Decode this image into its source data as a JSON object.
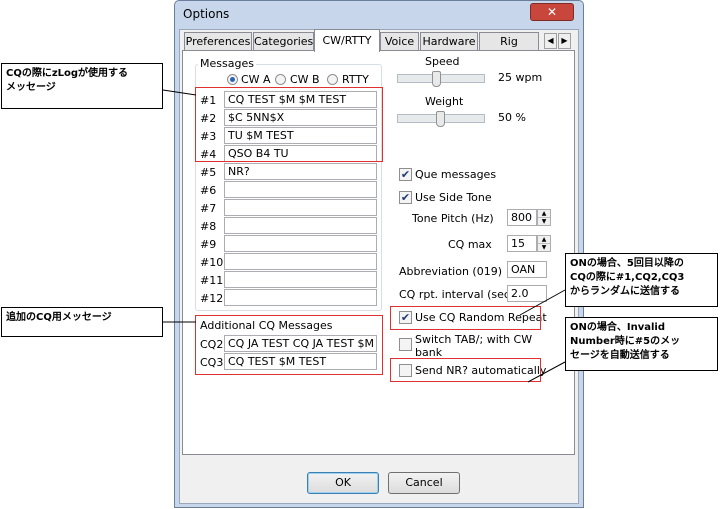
{
  "window": {
    "title": "Options",
    "close_glyph": "✕"
  },
  "tabs": [
    {
      "label": "Preferences"
    },
    {
      "label": "Categories"
    },
    {
      "label": "CW/RTTY"
    },
    {
      "label": "Voice"
    },
    {
      "label": "Hardware"
    },
    {
      "label": "Rig control"
    }
  ],
  "tab_scroll": {
    "left": "◀",
    "right": "▶"
  },
  "messages": {
    "group_label": "Messages",
    "banks": [
      {
        "label": "CW A",
        "selected": true
      },
      {
        "label": "CW B",
        "selected": false
      },
      {
        "label": "RTTY",
        "selected": false
      }
    ],
    "rows": [
      {
        "label": "#1",
        "value": "CQ TEST $M $M TEST"
      },
      {
        "label": "#2",
        "value": "$C 5NN$X"
      },
      {
        "label": "#3",
        "value": "TU $M TEST"
      },
      {
        "label": "#4",
        "value": "QSO B4 TU"
      },
      {
        "label": "#5",
        "value": "NR?"
      },
      {
        "label": "#6",
        "value": ""
      },
      {
        "label": "#7",
        "value": ""
      },
      {
        "label": "#8",
        "value": ""
      },
      {
        "label": "#9",
        "value": ""
      },
      {
        "label": "#10",
        "value": ""
      },
      {
        "label": "#11",
        "value": ""
      },
      {
        "label": "#12",
        "value": ""
      }
    ]
  },
  "additional_cq": {
    "group_label": "Additional CQ Messages",
    "rows": [
      {
        "label": "CQ2",
        "value": "CQ JA TEST CQ JA TEST $M"
      },
      {
        "label": "CQ3",
        "value": "CQ TEST $M TEST"
      }
    ]
  },
  "speed": {
    "label": "Speed",
    "value_text": "25 wpm",
    "level": 0.5
  },
  "weight": {
    "label": "Weight",
    "value_text": "50 %",
    "level": 0.5
  },
  "options": {
    "que_messages": {
      "label": "Que messages",
      "checked": true
    },
    "use_side_tone": {
      "label": "Use Side Tone",
      "checked": true
    },
    "tone_pitch": {
      "label": "Tone Pitch (Hz)",
      "value": "800"
    },
    "cq_max": {
      "label": "CQ max",
      "value": "15"
    },
    "abbreviation": {
      "label": "Abbreviation (019)",
      "value": "OAN"
    },
    "cq_rpt_interval": {
      "label": "CQ rpt. interval (sec)",
      "value": "2.0"
    },
    "use_cq_random_repeat": {
      "label": "Use CQ Random Repeat",
      "checked": true
    },
    "switch_tab": {
      "label_line1": "Switch TAB/; with CW",
      "label_line2": "bank",
      "checked": false
    },
    "send_nr_auto": {
      "label": "Send NR? automatically",
      "checked": false
    }
  },
  "check_glyph": "✔",
  "buttons": {
    "ok": "OK",
    "cancel": "Cancel"
  },
  "annotations": {
    "cq_messages_line1": "CQの際にzLogが使用する",
    "cq_messages_line2": "メッセージ",
    "additional_cq": "追加のCQ用メッセージ",
    "random_repeat_line1": "ONの場合、5回目以降の",
    "random_repeat_line2": "CQの際に#1,CQ2,CQ3",
    "random_repeat_line3": "からランダムに送信する",
    "send_nr_line1": "ONの場合、Invalid",
    "send_nr_line2": "Number時に#5のメッ",
    "send_nr_line3": "セージを自動送信する"
  },
  "colors": {
    "annotation_red": "#e03030",
    "title_bar": "#c7d6ea",
    "close_button": "#c9463d"
  }
}
